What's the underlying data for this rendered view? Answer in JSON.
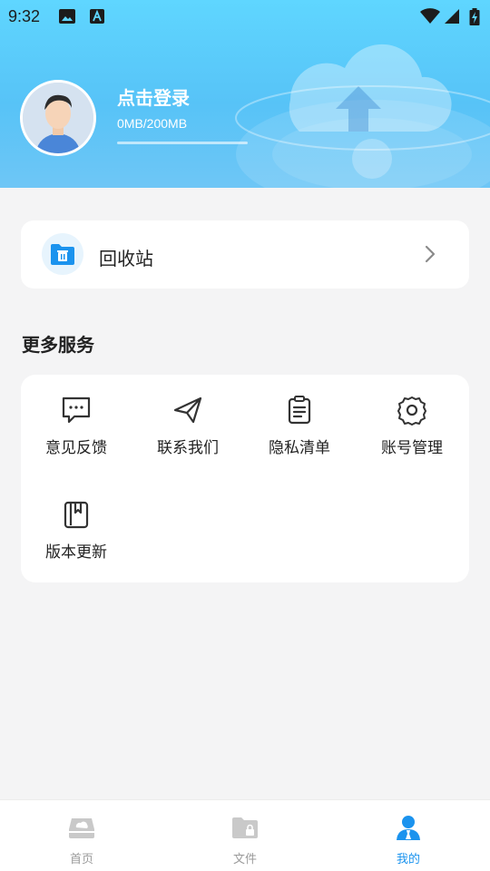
{
  "status_bar": {
    "time": "9:32"
  },
  "profile": {
    "login_prompt": "点击登录",
    "storage_text": "0MB/200MB",
    "storage_fraction": 0.0
  },
  "recycle_bin": {
    "label": "回收站"
  },
  "more_services": {
    "title": "更多服务",
    "items": [
      {
        "label": "意见反馈",
        "icon": "feedback-message-icon"
      },
      {
        "label": "联系我们",
        "icon": "paper-plane-icon"
      },
      {
        "label": "隐私清单",
        "icon": "clipboard-list-icon"
      },
      {
        "label": "账号管理",
        "icon": "gear-icon"
      },
      {
        "label": "版本更新",
        "icon": "bookmark-book-icon"
      }
    ]
  },
  "tabbar": {
    "tabs": [
      {
        "label": "首页",
        "icon": "drive-home-icon",
        "active": false
      },
      {
        "label": "文件",
        "icon": "folder-lock-icon",
        "active": false
      },
      {
        "label": "我的",
        "icon": "user-profile-icon",
        "active": true
      }
    ]
  },
  "colors": {
    "accent": "#1b93ee",
    "header_top": "#5fd6ff",
    "header_bottom": "#6ec6f6",
    "page_background": "#f4f4f5"
  }
}
